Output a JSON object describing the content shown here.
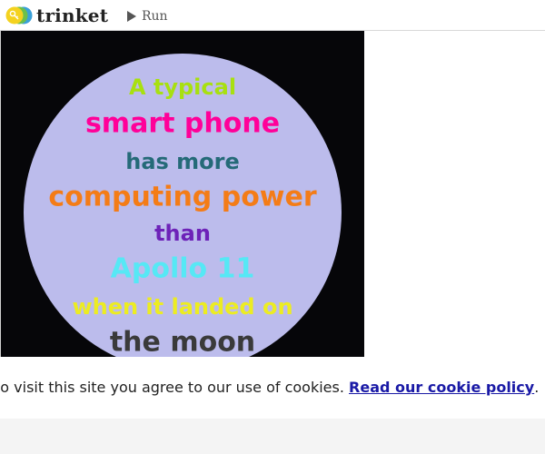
{
  "app": {
    "logo_text": "trinket",
    "run_label": "Run"
  },
  "canvas": {
    "background": "#060609",
    "circle_fill": "#bcbcec",
    "lines": [
      {
        "text": "A typical",
        "color": "#a8e010"
      },
      {
        "text": "smart phone",
        "color": "#ff0099"
      },
      {
        "text": "has more",
        "color": "#256a78"
      },
      {
        "text": "computing power",
        "color": "#f47c17"
      },
      {
        "text": "than",
        "color": "#6d22b8"
      },
      {
        "text": "Apollo 11",
        "color": "#56e8f5"
      },
      {
        "text": "when it landed on",
        "color": "#ecec22"
      },
      {
        "text": "the moon",
        "color": "#3a3a3a"
      }
    ]
  },
  "cookie_notice": {
    "text": "to visit this site you agree to our use of cookies. ",
    "link_label": "Read our cookie policy",
    "end": "."
  }
}
